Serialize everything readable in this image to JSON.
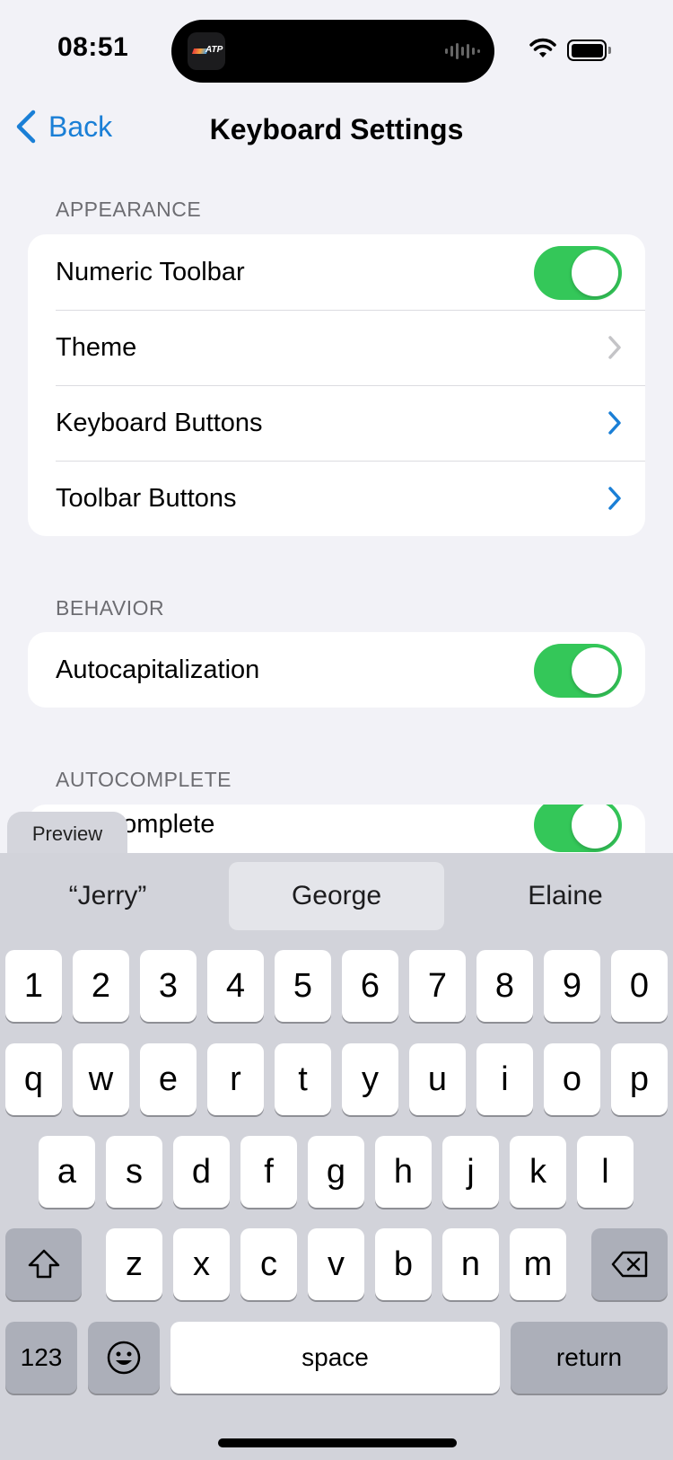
{
  "status_bar": {
    "time": "08:51",
    "island_app_label": "ATP",
    "icons": [
      "wifi-icon",
      "battery-icon"
    ]
  },
  "nav": {
    "back_label": "Back",
    "title": "Keyboard Settings"
  },
  "sections": {
    "appearance": {
      "header": "APPEARANCE",
      "rows": [
        {
          "label": "Numeric Toolbar",
          "control": "toggle",
          "on": true
        },
        {
          "label": "Theme",
          "control": "chevron",
          "chevron_color": "#c4c4c7"
        },
        {
          "label": "Keyboard Buttons",
          "control": "chevron",
          "chevron_color": "#1a7fd6"
        },
        {
          "label": "Toolbar Buttons",
          "control": "chevron",
          "chevron_color": "#1a7fd6"
        }
      ]
    },
    "behavior": {
      "header": "BEHAVIOR",
      "rows": [
        {
          "label": "Autocapitalization",
          "control": "toggle",
          "on": true
        }
      ]
    },
    "autocomplete": {
      "header": "AUTOCOMPLETE",
      "rows": [
        {
          "label": "Autocomplete",
          "control": "toggle",
          "on": true
        }
      ]
    }
  },
  "keyboard": {
    "preview_label": "Preview",
    "suggestions": [
      "“Jerry”",
      "George",
      "Elaine"
    ],
    "row_numbers": [
      "1",
      "2",
      "3",
      "4",
      "5",
      "6",
      "7",
      "8",
      "9",
      "0"
    ],
    "row_1": [
      "q",
      "w",
      "e",
      "r",
      "t",
      "y",
      "u",
      "i",
      "o",
      "p"
    ],
    "row_2": [
      "a",
      "s",
      "d",
      "f",
      "g",
      "h",
      "j",
      "k",
      "l"
    ],
    "row_3": [
      "z",
      "x",
      "c",
      "v",
      "b",
      "n",
      "m"
    ],
    "numbers_key": "123",
    "space_key": "space",
    "return_key": "return"
  },
  "colors": {
    "accent": "#1a7fd6",
    "toggle_on": "#34c759",
    "background": "#f2f2f7",
    "keyboard_bg": "#d2d3da"
  }
}
